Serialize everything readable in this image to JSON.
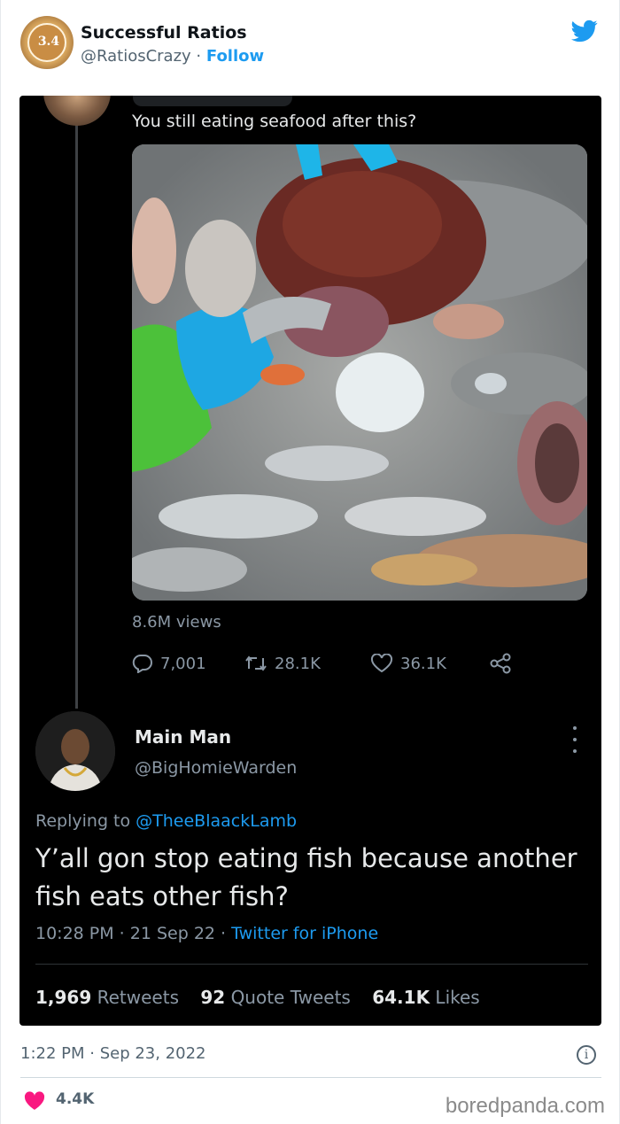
{
  "header": {
    "account_name": "Successful Ratios",
    "handle": "@RatiosCrazy",
    "separator": " · ",
    "follow_label": "Follow",
    "logo_text": "3.4"
  },
  "quoted_tweet": {
    "text": "You still eating seafood after this?",
    "views": "8.6M views",
    "replies": "7,001",
    "retweets": "28.1K",
    "likes": "36.1K"
  },
  "reply_tweet": {
    "name": "Main Man",
    "handle": "@BigHomieWarden",
    "replying_prefix": "Replying to ",
    "replying_to": "@TheeBlaackLamb",
    "text": "Y’all gon stop eating fish because another fish eats other fish?",
    "time": "10:28 PM · 21 Sep 22 · ",
    "source": "Twitter for iPhone",
    "retweets_count": "1,969",
    "retweets_label": "Retweets",
    "quote_count": "92",
    "quote_label": "Quote Tweets",
    "likes_count": "64.1K",
    "likes_label": "Likes"
  },
  "footer": {
    "timestamp": "1:22 PM · Sep 23, 2022",
    "info_glyph": "i",
    "likes": "4.4K",
    "watermark": "boredpanda.com"
  },
  "colors": {
    "accent": "#1d9bf0",
    "heart": "#f91880",
    "card_bg": "#000000"
  },
  "icons": [
    "twitter-bird-icon",
    "reply-icon",
    "retweet-icon",
    "like-icon",
    "share-icon",
    "more-icon",
    "info-icon",
    "heart-icon"
  ]
}
